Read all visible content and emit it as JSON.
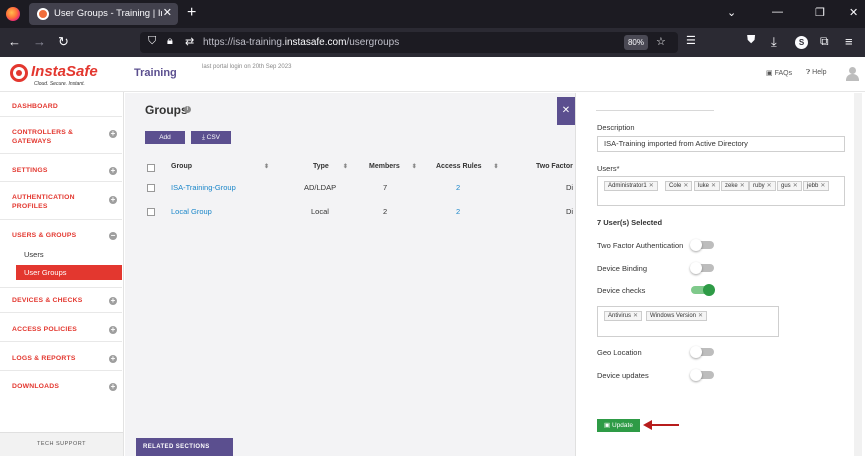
{
  "browser": {
    "tab_title": "User Groups - Training | InstaSafe",
    "url_prefix": "https://isa-training.",
    "url_domain": "instasafe.com",
    "url_path": "/usergroups",
    "zoom": "80%",
    "account_initial": "S"
  },
  "header": {
    "logo": "InstaSafe",
    "logo_tagline": "Cloud. Secure. Instant.",
    "app_title": "Training",
    "last_login": "last portal login on 20th Sep 2023",
    "faqs_label": "FAQs",
    "help_label": "Help"
  },
  "sidebar": {
    "items": [
      {
        "label": "DASHBOARD"
      },
      {
        "label": "CONTROLLERS &"
      },
      {
        "label": "GATEWAYS"
      },
      {
        "label": "SETTINGS"
      },
      {
        "label": "AUTHENTICATION"
      },
      {
        "label": "PROFILES"
      },
      {
        "label": "USERS & GROUPS"
      },
      {
        "label": "DEVICES & CHECKS"
      },
      {
        "label": "ACCESS POLICIES"
      },
      {
        "label": "LOGS & REPORTS"
      },
      {
        "label": "DOWNLOADS"
      }
    ],
    "sub_users": "Users",
    "sub_user_groups": "User Groups",
    "tech_support": "TECH SUPPORT"
  },
  "main": {
    "title": "Groups",
    "add_label": "Add",
    "csv_label": "CSV",
    "columns": [
      "Group",
      "Type",
      "Members",
      "Access Rules",
      "Two Factor"
    ],
    "rows": [
      {
        "group": "ISA-Training-Group",
        "type": "AD/LDAP",
        "members": "7",
        "rules": "2",
        "twofactor": "Di"
      },
      {
        "group": "Local Group",
        "type": "Local",
        "members": "2",
        "rules": "2",
        "twofactor": "Di"
      }
    ],
    "related_sections": "RELATED SECTIONS"
  },
  "panel": {
    "description_label": "Description",
    "description_value": "ISA-Training imported from Active Directory",
    "users_label": "Users*",
    "users": [
      "Administrator1",
      "Cole",
      "luke",
      "zeke",
      "ruby",
      "gus",
      "jebb"
    ],
    "users_selected": "7 User(s) Selected",
    "two_factor_label": "Two Factor Authentication",
    "device_binding_label": "Device Binding",
    "device_checks_label": "Device checks",
    "checks": [
      "Antivirus",
      "Windows Version"
    ],
    "geo_location_label": "Geo Location",
    "device_updates_label": "Device updates",
    "toggles": {
      "two_factor": false,
      "device_binding": false,
      "device_checks": true,
      "geo_location": false,
      "device_updates": false
    },
    "update_label": "Update",
    "colors": {
      "primary": "#5b4f8f",
      "accent": "#e3372f",
      "success": "#2e9b46",
      "link": "#1a86c9",
      "arrow": "#b71c1c"
    }
  }
}
